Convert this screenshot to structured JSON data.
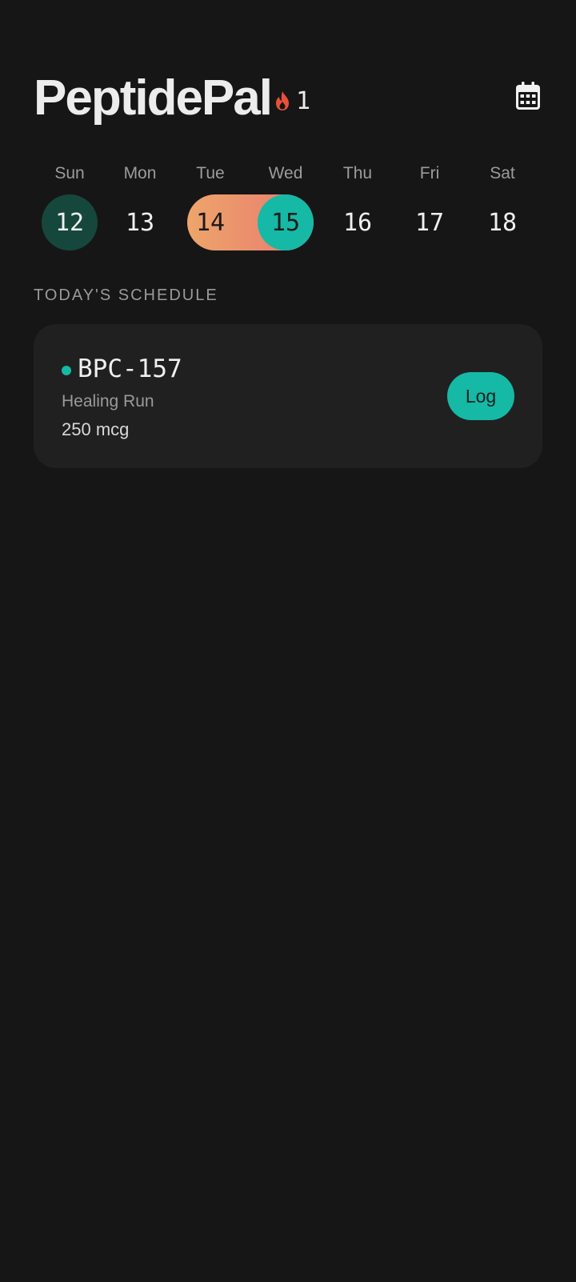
{
  "app": {
    "title": "PeptidePal",
    "streak_icon": "flame-icon",
    "streak_count": "1",
    "calendar_icon": "calendar-icon"
  },
  "week": {
    "days": [
      {
        "name": "Sun",
        "num": "12",
        "state": "past"
      },
      {
        "name": "Mon",
        "num": "13",
        "state": "default"
      },
      {
        "name": "Tue",
        "num": "14",
        "state": "range"
      },
      {
        "name": "Wed",
        "num": "15",
        "state": "today"
      },
      {
        "name": "Thu",
        "num": "16",
        "state": "default"
      },
      {
        "name": "Fri",
        "num": "17",
        "state": "default"
      },
      {
        "name": "Sat",
        "num": "18",
        "state": "default"
      }
    ]
  },
  "schedule": {
    "label": "TODAY'S SCHEDULE",
    "items": [
      {
        "name": "BPC-157",
        "protocol": "Healing Run",
        "amount": "250 mcg",
        "action_label": "Log"
      }
    ]
  },
  "colors": {
    "background": "#161616",
    "card": "#202020",
    "accent": "#15b9a5",
    "past_day": "#16473d",
    "range_start": "#eea56b",
    "range_end": "#e07a72",
    "flame": "#e8503a"
  }
}
